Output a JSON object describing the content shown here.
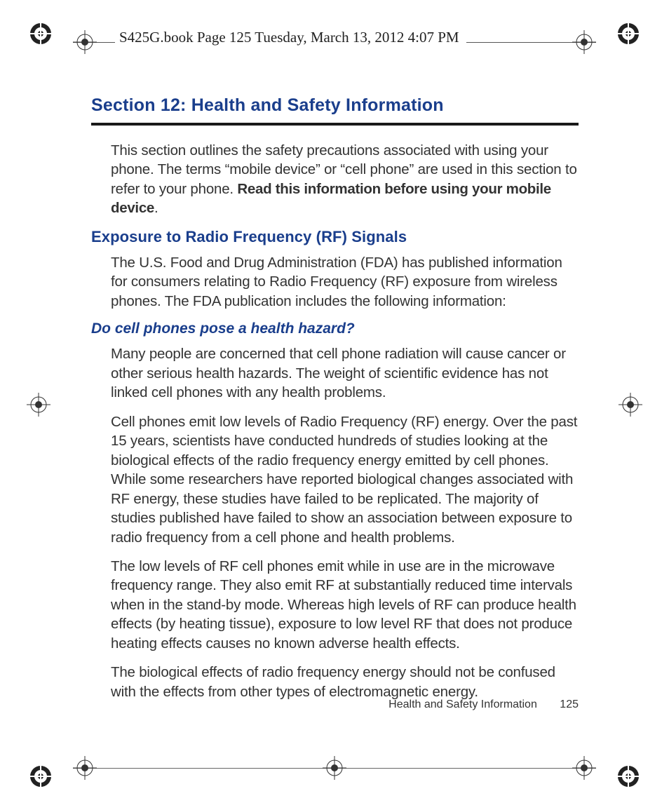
{
  "header": {
    "tagline": "S425G.book  Page 125  Tuesday, March 13, 2012  4:07 PM"
  },
  "section": {
    "title": "Section 12: Health and Safety Information",
    "intro_pre": "This section outlines the safety precautions associated with using your phone. The terms “mobile device” or “cell phone” are used in this section to refer to your phone. ",
    "intro_bold": "Read this information before using your mobile device",
    "h2": "Exposure to Radio Frequency (RF) Signals",
    "p2": "The U.S. Food and Drug Administration (FDA) has published information for consumers relating to Radio Frequency (RF) exposure from wireless phones. The FDA publication includes the following information:",
    "h3": "Do cell phones pose a health hazard?",
    "p3": "Many people are concerned that cell phone radiation will cause cancer or other serious health hazards. The weight of scientific evidence has not linked cell phones with any health problems.",
    "p4": "Cell phones emit low levels of Radio Frequency (RF) energy. Over the past 15 years, scientists have conducted hundreds of studies looking at the biological effects of the radio frequency energy emitted by cell phones. While some researchers have reported biological changes associated with RF energy, these studies have failed to be replicated. The majority of studies published have failed to show an association between exposure to radio frequency from a cell phone and health problems.",
    "p5": "The low levels of RF cell phones emit while in use are in the microwave frequency range. They also emit RF at substantially reduced time intervals when in the stand-by mode. Whereas high levels of RF can produce health effects (by heating tissue), exposure to low level RF that does not produce heating effects causes no known adverse health effects.",
    "p6": "The biological effects of radio frequency energy should not be confused with the effects from other types of electromagnetic energy."
  },
  "footer": {
    "label": "Health and Safety Information",
    "page": "125"
  }
}
